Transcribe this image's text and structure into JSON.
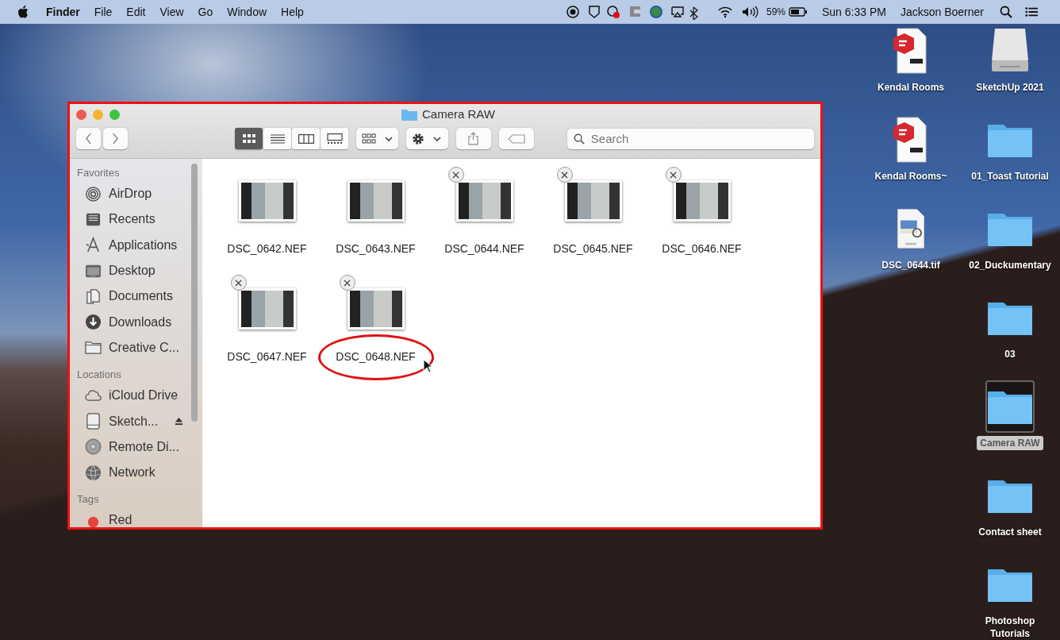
{
  "menu_bar": {
    "app_name": "Finder",
    "menus": [
      "File",
      "Edit",
      "View",
      "Go",
      "Window",
      "Help"
    ],
    "battery_percent": "59%",
    "clock": "Sun 6:33 PM",
    "user": "Jackson Boerner"
  },
  "window": {
    "title": "Camera RAW",
    "toolbar": {
      "view_modes": [
        {
          "kind": "icons",
          "selected": true
        },
        {
          "kind": "list",
          "selected": false
        },
        {
          "kind": "columns",
          "selected": false
        },
        {
          "kind": "gallery",
          "selected": false
        }
      ],
      "search": {
        "placeholder": "Search"
      }
    },
    "sidebar": [
      {
        "heading": "Favorites",
        "items": [
          {
            "label": "AirDrop",
            "kind": "airdrop"
          },
          {
            "label": "Recents",
            "kind": "recents"
          },
          {
            "label": "Applications",
            "kind": "applications"
          },
          {
            "label": "Desktop",
            "kind": "desktop"
          },
          {
            "label": "Documents",
            "kind": "documents"
          },
          {
            "label": "Downloads",
            "kind": "downloads"
          },
          {
            "label": "Creative C...",
            "kind": "folder"
          }
        ]
      },
      {
        "heading": "Locations",
        "items": [
          {
            "label": "iCloud Drive",
            "kind": "cloud"
          },
          {
            "label": "Sketch...",
            "kind": "drive",
            "eject": true
          },
          {
            "label": "Remote Di...",
            "kind": "disc"
          },
          {
            "label": "Network",
            "kind": "network"
          }
        ]
      },
      {
        "heading": "Tags",
        "items": [
          {
            "label": "Red",
            "kind": "tag",
            "color": "#e8423c"
          }
        ]
      }
    ],
    "files": [
      {
        "name": "DSC_0642.NEF",
        "remove_badge": false,
        "circled": false
      },
      {
        "name": "DSC_0643.NEF",
        "remove_badge": false,
        "circled": false
      },
      {
        "name": "DSC_0644.NEF",
        "remove_badge": true,
        "circled": false
      },
      {
        "name": "DSC_0645.NEF",
        "remove_badge": true,
        "circled": false
      },
      {
        "name": "DSC_0646.NEF",
        "remove_badge": true,
        "circled": false
      },
      {
        "name": "DSC_0647.NEF",
        "remove_badge": true,
        "circled": false
      },
      {
        "name": "DSC_0648.NEF",
        "remove_badge": true,
        "circled": true
      }
    ]
  },
  "desktop": {
    "left_column": [
      {
        "label": "Kendal Rooms",
        "kind": "skp",
        "selected": false
      },
      {
        "label": "Kendal Rooms~",
        "kind": "skp",
        "selected": false
      },
      {
        "label": "DSC_0644.tif",
        "kind": "tiff",
        "selected": false
      }
    ],
    "right_column": [
      {
        "label": "SketchUp 2021",
        "kind": "drive",
        "selected": false
      },
      {
        "label": "01_Toast Tutorial",
        "kind": "folder",
        "selected": false
      },
      {
        "label": "02_Duckumentary",
        "kind": "folder",
        "selected": false
      },
      {
        "label": "03",
        "kind": "folder",
        "selected": false
      },
      {
        "label": "Camera RAW",
        "kind": "folder",
        "selected": true
      },
      {
        "label": "Contact sheet",
        "kind": "folder",
        "selected": false
      },
      {
        "label": "Photoshop Tutorials",
        "kind": "folder",
        "selected": false
      }
    ]
  }
}
